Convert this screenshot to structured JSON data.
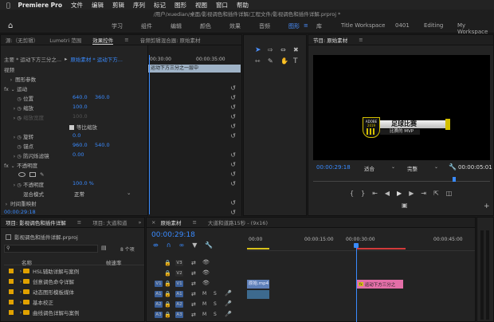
{
  "menubar": {
    "app": "Premiere Pro",
    "items": [
      "文件",
      "编辑",
      "剪辑",
      "序列",
      "标记",
      "图形",
      "视图",
      "窗口",
      "帮助"
    ]
  },
  "title": "/用户/xuedian/桌面/影视调色和插件详解/工程文件/影视调色和插件详解.prproj *",
  "workspaces": [
    "学习",
    "组件",
    "编辑",
    "颜色",
    "效果",
    "音频",
    "图形",
    "库",
    "Title Workspace",
    "0401",
    "Editing",
    "My Workspace"
  ],
  "active_workspace": "图形",
  "left_panel": {
    "tabs": [
      "源:（无剪辑）",
      "Lumetri 范围",
      "效果控件",
      "音频剪辑混合器: 原始素材"
    ],
    "master": "主要 * 运动下方三分之...",
    "clip": "原始素材 * 运动下方...",
    "ruler_start": "00:30:00",
    "ruler_end": "00:00:35:00",
    "clip_bar": "运动下方三分之一层中",
    "section_video": "视频",
    "graphics_params": "图形参数",
    "motion": "运动",
    "position_label": "位置",
    "position_x": "640.0",
    "position_y": "360.0",
    "scale_label": "缩放",
    "scale_val": "100.0",
    "scale_width_label": "缩放宽度",
    "scale_width_val": "100.0",
    "uniform_label": "等比缩放",
    "rotation_label": "旋转",
    "rotation_val": "0.0",
    "anchor_label": "锚点",
    "anchor_x": "960.0",
    "anchor_y": "540.0",
    "flicker_label": "防闪烁滤镜",
    "flicker_val": "0.00",
    "opacity_section": "不透明度",
    "opacity_label": "不透明度",
    "opacity_val": "100.0 %",
    "blend_label": "混合模式",
    "blend_val": "正常",
    "time_remap": "时间重映射",
    "timecode": "00:00:29:18"
  },
  "program": {
    "tab": "节目: 原始素材",
    "timecode": "00:00:29:18",
    "fit": "适合",
    "quality": "完整",
    "duration": "00:00:05:01",
    "logo_top": "ADOBE",
    "logo_year": "2019",
    "lower_third_title": "足球比赛",
    "lower_third_sub": "比赛的 MVP"
  },
  "project": {
    "tabs": [
      "项目: 影视调色和插件详解",
      "项目: 大道和道",
      "»"
    ],
    "file": "影视调色和插件详解.prproj",
    "count": "8 个项",
    "col_name": "名称",
    "col_rate": "帧速率",
    "items": [
      "HSL辅助详解与案例",
      "创意调色命令详解",
      "动态图形模板媒体",
      "基本校正",
      "曲线调色详解与案例"
    ]
  },
  "timeline": {
    "tabs": [
      "原始素材",
      "大道和道路15秒 - (9x16)"
    ],
    "timecode": "00:00:29:18",
    "ruler": [
      "00:00",
      "00:00:15:00",
      "00:00:30:00",
      "00:00:45:00"
    ],
    "tracks": [
      "V3",
      "V2",
      "V1",
      "A1",
      "A2",
      "A3"
    ],
    "clip_v1a": "原始.mp4 [V]",
    "clip_v1b": "运动下方三分之"
  }
}
